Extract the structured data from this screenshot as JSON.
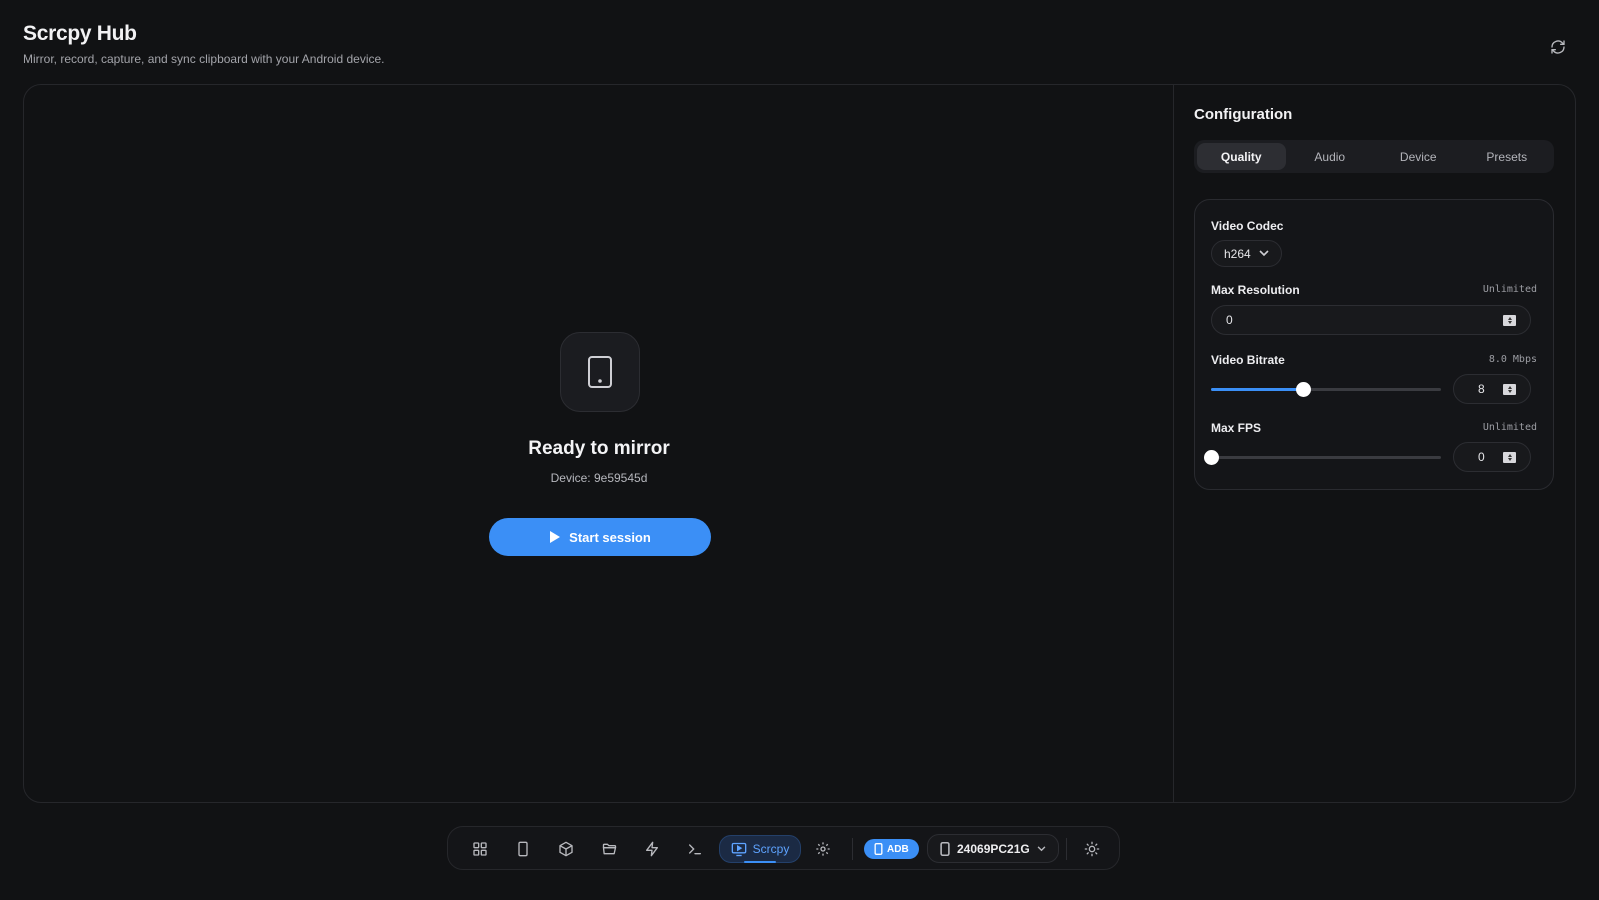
{
  "app": {
    "title": "Scrcpy Hub",
    "subtitle": "Mirror, record, capture, and sync clipboard with your Android device."
  },
  "preview": {
    "heading": "Ready to mirror",
    "device_line": "Device: 9e59545d",
    "start_label": "Start session"
  },
  "config": {
    "title": "Configuration",
    "tabs": [
      {
        "label": "Quality",
        "active": true
      },
      {
        "label": "Audio",
        "active": false
      },
      {
        "label": "Device",
        "active": false
      },
      {
        "label": "Presets",
        "active": false
      }
    ],
    "video_codec": {
      "label": "Video Codec",
      "value": "h264"
    },
    "max_resolution": {
      "label": "Max Resolution",
      "hint": "Unlimited",
      "value": "0"
    },
    "video_bitrate": {
      "label": "Video Bitrate",
      "hint": "8.0 Mbps",
      "value": "8",
      "slider_fraction": 0.4
    },
    "max_fps": {
      "label": "Max FPS",
      "hint": "Unlimited",
      "value": "0",
      "slider_fraction": 0.0
    }
  },
  "dock": {
    "items": [
      "grid-icon",
      "phone-icon",
      "package-icon",
      "folder-icon",
      "bolt-icon",
      "terminal-icon"
    ],
    "active_label": "Scrcpy",
    "adb_label": "ADB",
    "device_label": "24069PC21G"
  },
  "colors": {
    "accent": "#3b8ff6",
    "background": "#111214"
  }
}
